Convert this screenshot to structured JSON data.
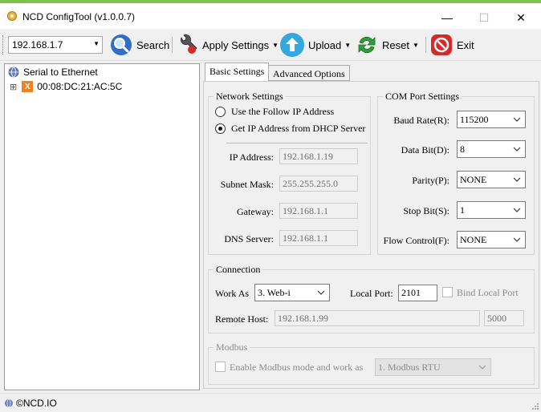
{
  "window": {
    "title": "NCD ConfigTool (v1.0.0.7)",
    "min_glyph": "—",
    "max_glyph": "☐",
    "close_glyph": "✕"
  },
  "toolbar": {
    "ip_value": "192.168.1.7",
    "search_label": "Search",
    "apply_label": "Apply Settings",
    "upload_label": "Upload",
    "reset_label": "Reset",
    "exit_label": "Exit",
    "caret": "▼"
  },
  "tree": {
    "root_label": "Serial to Ethernet",
    "expander": "⊞",
    "device_badge": "X",
    "device_label": "00:08:DC:21:AC:5C"
  },
  "tabs": {
    "basic": "Basic Settings",
    "advanced": "Advanced Options"
  },
  "network": {
    "title": "Network Settings",
    "radio_follow_ip": "Use the Follow IP Address",
    "radio_dhcp": "Get IP Address from DHCP Server",
    "ip_label": "IP Address:",
    "ip_value": "192.168.1.19",
    "subnet_label": "Subnet Mask:",
    "subnet_value": "255.255.255.0",
    "gateway_label": "Gateway:",
    "gateway_value": "192.168.1.1",
    "dns_label": "DNS Server:",
    "dns_value": "192.168.1.1"
  },
  "com": {
    "title": "COM Port Settings",
    "baud_label": "Baud Rate(R):",
    "baud_value": "115200",
    "databit_label": "Data Bit(D):",
    "databit_value": "8",
    "parity_label": "Parity(P):",
    "parity_value": "NONE",
    "stopbit_label": "Stop Bit(S):",
    "stopbit_value": "1",
    "flow_label": "Flow Control(F):",
    "flow_value": "NONE"
  },
  "connection": {
    "title": "Connection",
    "work_as_label": "Work As",
    "work_as_value": "3. Web-i",
    "local_port_label": "Local Port:",
    "local_port_value": "2101",
    "bind_label": "Bind Local Port",
    "remote_host_label": "Remote Host:",
    "remote_host_value": "192.168.1.99",
    "remote_port_value": "5000"
  },
  "modbus": {
    "title": "Modbus",
    "enable_label": "Enable Modbus mode and work as",
    "mode_value": "1. Modbus RTU"
  },
  "status": {
    "text": "©NCD.IO"
  },
  "colors": {
    "accent": "#7cc24b",
    "search_icon_blue": "#2f6fc8",
    "upload_blue": "#35a8e0",
    "reset_green": "#2e9e3c",
    "exit_red": "#d32b2b",
    "device_badge_orange": "#f0821e"
  }
}
